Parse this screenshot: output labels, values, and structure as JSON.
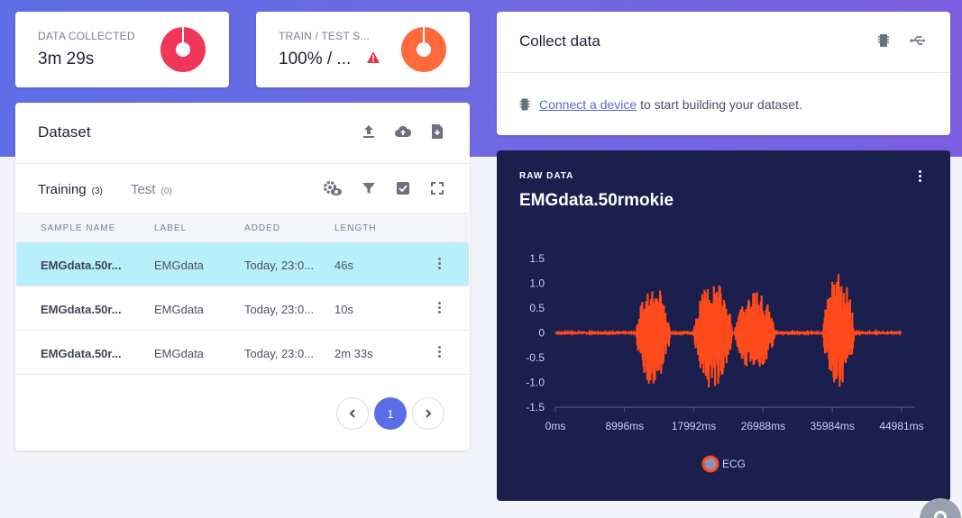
{
  "stats": {
    "data_collected": {
      "label": "DATA COLLECTED",
      "value": "3m 29s",
      "color": "#f0375a"
    },
    "train_test": {
      "label": "TRAIN / TEST S...",
      "value": "100% / ...",
      "color": "#ff6a3d",
      "warning_color": "#e8354a"
    }
  },
  "dataset": {
    "title": "Dataset",
    "tabs": [
      {
        "label": "Training",
        "count": "(3)"
      },
      {
        "label": "Test",
        "count": "(0)"
      }
    ],
    "columns": [
      "SAMPLE NAME",
      "LABEL",
      "ADDED",
      "LENGTH"
    ],
    "rows": [
      {
        "name": "EMGdata.50r...",
        "label": "EMGdata",
        "added": "Today, 23:0...",
        "length": "46s"
      },
      {
        "name": "EMGdata.50r...",
        "label": "EMGdata",
        "added": "Today, 23:0...",
        "length": "10s"
      },
      {
        "name": "EMGdata.50r...",
        "label": "EMGdata",
        "added": "Today, 23:0...",
        "length": "2m 33s"
      }
    ],
    "pagination": {
      "current": "1"
    }
  },
  "collect": {
    "title": "Collect data",
    "link_text": "Connect a device",
    "message": " to start building your dataset."
  },
  "raw": {
    "heading": "RAW DATA",
    "sample_name": "EMGdata.50rmokie"
  },
  "chart_data": {
    "type": "line",
    "title": "",
    "xlabel": "",
    "ylabel": "",
    "x_ticks": [
      "0ms",
      "8996ms",
      "17992ms",
      "26988ms",
      "35984ms",
      "44981ms"
    ],
    "y_ticks": [
      "1.5",
      "1.0",
      "0.5",
      "0",
      "-0.5",
      "-1.0",
      "-1.5"
    ],
    "xlim": [
      0,
      44981
    ],
    "ylim": [
      -1.5,
      1.5
    ],
    "legend": "bottom",
    "series": [
      {
        "name": "ECG",
        "color": "#ff4a1c",
        "bursts": [
          {
            "start_ms": 10500,
            "end_ms": 14900,
            "max": 1.0,
            "min": -1.1
          },
          {
            "start_ms": 18000,
            "end_ms": 23000,
            "max": 1.05,
            "min": -1.15
          },
          {
            "start_ms": 23300,
            "end_ms": 28500,
            "max": 0.85,
            "min": -0.8
          },
          {
            "start_ms": 34800,
            "end_ms": 38800,
            "max": 1.2,
            "min": -1.15
          }
        ],
        "baseline": 0.0
      }
    ],
    "colors": {
      "background": "#1b1f4d",
      "axis_text": "#c9cdf0",
      "axis_line": "#5c6090"
    }
  }
}
